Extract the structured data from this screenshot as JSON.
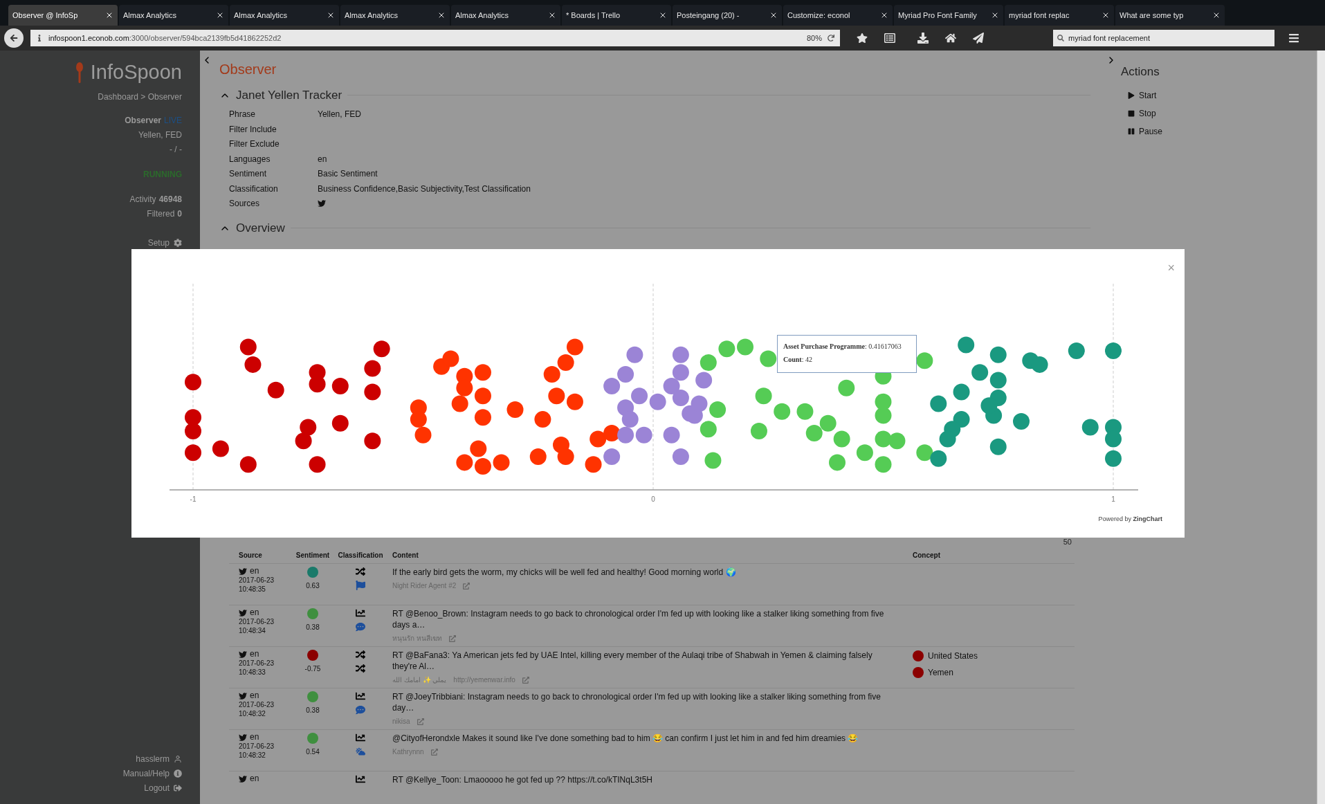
{
  "browser": {
    "tabs": [
      {
        "label": "Observer @ InfoSp",
        "selected": true
      },
      {
        "label": "Almax Analytics",
        "selected": false
      },
      {
        "label": "Almax Analytics",
        "selected": false
      },
      {
        "label": "Almax Analytics",
        "selected": false
      },
      {
        "label": "Almax Analytics",
        "selected": false
      },
      {
        "label": "* Boards | Trello",
        "selected": false
      },
      {
        "label": "Posteingang (20) -",
        "selected": false
      },
      {
        "label": "Customize: econol",
        "selected": false
      },
      {
        "label": "Myriad Pro Font Family",
        "selected": false
      },
      {
        "label": "myriad font replac",
        "selected": false
      },
      {
        "label": "What are some typ",
        "selected": false
      }
    ],
    "url_host": "infospoon1.econob.com",
    "url_path": ":3000/observer/594bca2139fb5d41862252d2",
    "zoom": "80%",
    "search": "myriad font replacement"
  },
  "sidebar": {
    "logo": "InfoSpoon",
    "breadcrumb": "Dashboard > Observer",
    "observer_label": "Observer",
    "live": "LIVE",
    "phrase": "Yellen, FED",
    "range": "- / -",
    "status": "RUNNING",
    "activity_label": "Activity",
    "activity": "46948",
    "filtered_label": "Filtered",
    "filtered": "0",
    "setup": "Setup",
    "footer": [
      {
        "label": "hasslerm",
        "kind": "user"
      },
      {
        "label": "Manual/Help",
        "kind": "info"
      },
      {
        "label": "Logout",
        "kind": "logout"
      }
    ]
  },
  "main": {
    "title": "Observer",
    "tracker": {
      "title": "Janet Yellen Tracker",
      "expanded": true,
      "fields": [
        {
          "label": "Phrase",
          "value": "Yellen, FED"
        },
        {
          "label": "Filter Include"
        },
        {
          "label": "Filter Exclude"
        },
        {
          "label": "Languages",
          "value": "en"
        },
        {
          "label": "Sentiment",
          "value": "Basic Sentiment"
        },
        {
          "label": "Classification",
          "value": "Business Confidence,Basic Subjectivity,Test Classification"
        },
        {
          "label": "Sources",
          "kind": "twitter"
        }
      ]
    },
    "overview": {
      "title": "Overview",
      "expanded": true
    },
    "count": "50",
    "table": {
      "columns": [
        "Source",
        "Sentiment",
        "Classification",
        "Content",
        "Concept"
      ],
      "rows": [
        {
          "lang": "en",
          "date": "2017-06-23",
          "time": "10:48:35",
          "score": "0.63",
          "color": "#1a7a6a",
          "classes": [
            {
              "kind": "shuffle"
            },
            {
              "kind": "flag"
            }
          ],
          "content": "If the early bird gets the worm, my chicks will be well fed and healthy! Good morning world 🌍",
          "author": "Night Rider Agent #2"
        },
        {
          "lang": "en",
          "date": "2017-06-23",
          "time": "10:48:34",
          "score": "0.38",
          "color": "#3f8f3f",
          "classes": [
            {
              "kind": "chart"
            },
            {
              "kind": "question"
            }
          ],
          "content": "RT @Benoo_Brown: Instagram needs to go back to chronological order I'm fed up with looking like a stalker liking something from five days a…",
          "author": "หนุนรัก หนสีเฆท"
        },
        {
          "lang": "en",
          "date": "2017-06-23",
          "time": "10:48:33",
          "score": "-0.75",
          "color": "#8b0000",
          "classes": [
            {
              "kind": "shuffle"
            },
            {
              "kind": "shuffle"
            }
          ],
          "content": "RT @BaFana3: Ya American jets fed by UAE Intel, killing every member of the Aulaqi tribe of Shabwah in Yemen & claiming falsely they're Al…",
          "author": "يملي ✨ امامك الله",
          "link": "http://yemenwar.info",
          "concepts": [
            {
              "label": "United States",
              "color": "#8b0000"
            },
            {
              "label": "Yemen",
              "color": "#8b0000"
            }
          ]
        },
        {
          "lang": "en",
          "date": "2017-06-23",
          "time": "10:48:32",
          "score": "0.38",
          "color": "#3f8f3f",
          "classes": [
            {
              "kind": "chart"
            },
            {
              "kind": "question"
            }
          ],
          "content": "RT @JoeyTribbiani: Instagram needs to go back to chronological order I'm fed up with looking like a stalker liking something from five day…",
          "author": "nikisa"
        },
        {
          "lang": "en",
          "date": "2017-06-23",
          "time": "10:48:32",
          "score": "0.54",
          "color": "#3f8f3f",
          "classes": [
            {
              "kind": "chart"
            },
            {
              "kind": "weather"
            }
          ],
          "content": "@CityofHerondxle Makes it sound like I've done something bad to him 😂 can confirm I just let him in and fed him dreamies 😂",
          "author": "Kathrynnn"
        },
        {
          "lang": "en",
          "classes": [
            {
              "kind": "chart"
            }
          ],
          "content": "RT @Kellye_Toon: Lmaooooo he got fed up ?? https://t.co/kTINqL3t5H"
        }
      ]
    }
  },
  "actions": {
    "title": "Actions",
    "items": [
      {
        "label": "Start",
        "kind": "play"
      },
      {
        "label": "Stop",
        "kind": "stop"
      },
      {
        "label": "Pause",
        "kind": "pause"
      }
    ]
  },
  "modal": {
    "close": "×",
    "tooltip": {
      "line1": "**Asset Purchase Programme**: 0.41617063",
      "line2": "**Count**: 42"
    },
    "credit": "Powered by **ZingChart**",
    "axis_labels": [
      "-1",
      "0",
      "1"
    ]
  }
}
